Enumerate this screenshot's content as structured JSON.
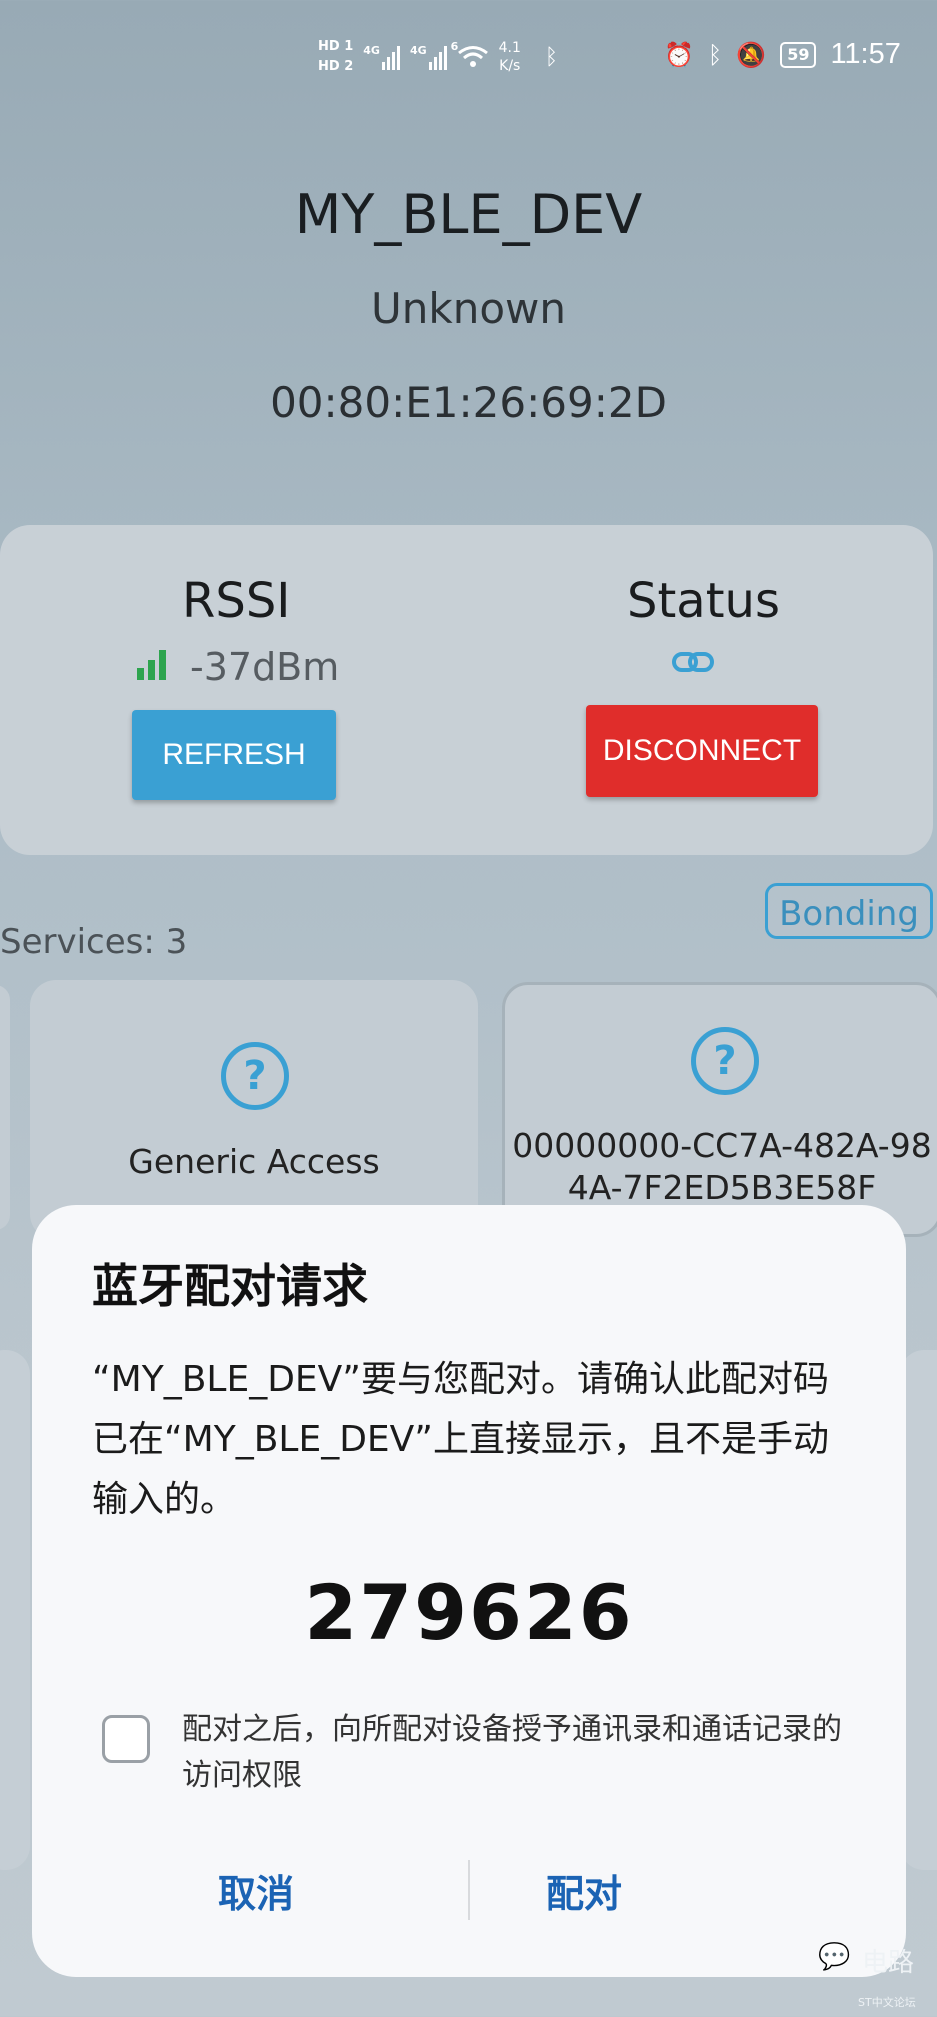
{
  "status_bar": {
    "hd1": "HD 1",
    "hd2": "HD 2",
    "net1": "4G",
    "net2": "4G",
    "wifi": "6",
    "speed_value": "4.1",
    "speed_unit": "K/s",
    "battery": "59",
    "time": "11:57",
    "icons": [
      "bluetooth-icon",
      "alarm-icon",
      "mute-icon"
    ]
  },
  "device": {
    "name": "MY_BLE_DEV",
    "type": "Unknown",
    "mac": "00:80:E1:26:69:2D"
  },
  "rssi": {
    "label": "RSSI",
    "value": "-37dBm",
    "refresh_label": "REFRESH"
  },
  "status": {
    "label": "Status",
    "disconnect_label": "DISCONNECT"
  },
  "bonding_label": "Bonding",
  "services_label": "Services: 3",
  "services": [
    {
      "title": "Generic Access"
    },
    {
      "title_line1": "00000000-CC7A-482A-98",
      "title_line2": "4A-7F2ED5B3E58F"
    }
  ],
  "dialog": {
    "title": "蓝牙配对请求",
    "message": "“MY_BLE_DEV”要与您配对。请确认此配对码已在“MY_BLE_DEV”上直接显示，且不是手动输入的。",
    "pin": "279626",
    "checkbox_text": "配对之后，向所配对设备授予通讯录和通话记录的访问权限",
    "checkbox_checked": false,
    "cancel_label": "取消",
    "pair_label": "配对"
  },
  "watermark": {
    "label": "电路",
    "sub": "ST中文论坛"
  },
  "colors": {
    "refresh": "#3aa0d3",
    "disconnect": "#e02d2b",
    "signal": "#2da44e",
    "dialog_button": "#1b63b4"
  }
}
